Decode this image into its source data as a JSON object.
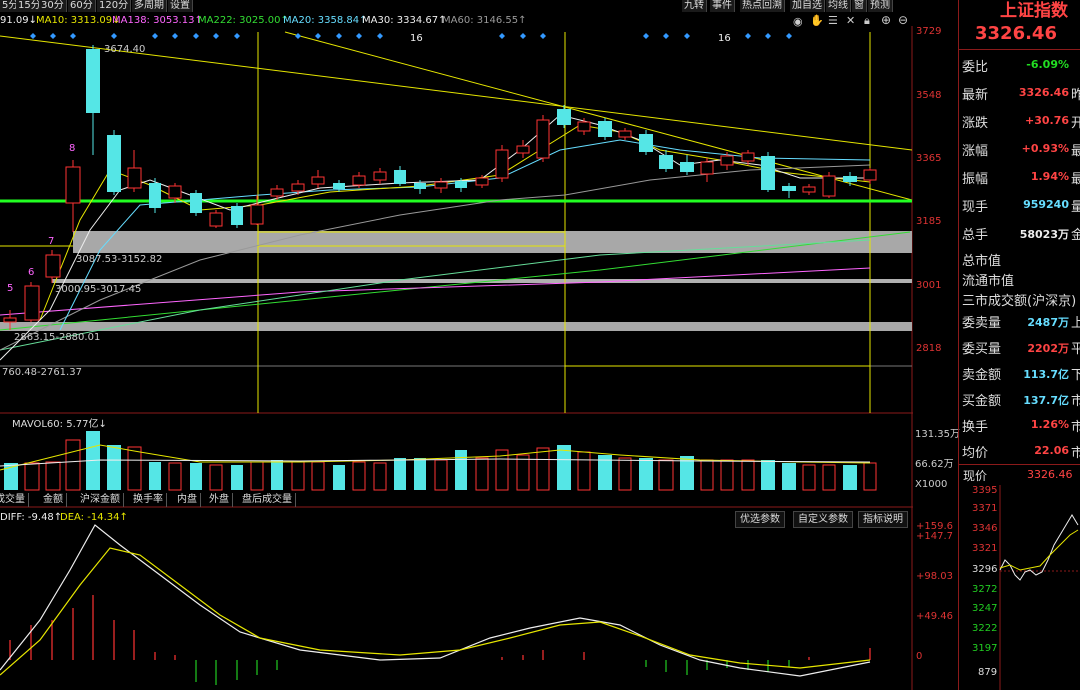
{
  "period_tabs": [
    "5分",
    "15分",
    "30分",
    "60分",
    "120分",
    "多周期",
    "设置"
  ],
  "tools": [
    "九转",
    "事件",
    "热点回溯",
    "加自选",
    "均线",
    "窗",
    "预测"
  ],
  "ma_legend": [
    {
      "text": "91.09↓",
      "color": "#eeeeee"
    },
    {
      "text": "MA10: 3313.09↓",
      "color": "#e6e600"
    },
    {
      "text": "MA138: 3053.13↑",
      "color": "#ff66ff"
    },
    {
      "text": "MA222: 3025.00↑",
      "color": "#33dd33"
    },
    {
      "text": "MA20: 3358.84↑",
      "color": "#66ddff"
    },
    {
      "text": "MA30: 3334.67↑",
      "color": "#eeeeee"
    },
    {
      "text": "MA60: 3146.55↑",
      "color": "#999999"
    }
  ],
  "price_axis": [
    "3729",
    "3548",
    "3365",
    "3185",
    "3001",
    "2818"
  ],
  "chart_labels": {
    "high": "3674.40",
    "count1": "16",
    "count2": "16",
    "n8": "8",
    "n7": "7",
    "n6": "6",
    "n5": "5",
    "zone1": "3087.53-3152.82",
    "zone2": "3000.95-3017.45",
    "zone3": "2863.15-2880.01",
    "zone4": "760.48-2761.37"
  },
  "volume": {
    "legend": "MAVOL60: 5.77亿↓",
    "axis": [
      "131.35万",
      "66.62万",
      "X1000"
    ],
    "tabs": [
      "成交量",
      "金额",
      "沪深金额",
      "换手率",
      "内盘",
      "外盘",
      "盘后成交量"
    ]
  },
  "macd": {
    "diff": "DIFF: -9.48↑",
    "dea": "DEA: -14.34↑",
    "buttons": [
      "优选参数",
      "自定义参数",
      "指标说明"
    ],
    "axis": [
      "+159.6",
      "+147.7",
      "+98.03",
      "+49.46",
      "0"
    ]
  },
  "quote": {
    "title": "上证指数",
    "price": "3326.46",
    "rows": [
      {
        "label": "委比",
        "value": "-6.09%",
        "color": "#22dd22",
        "cut": ""
      },
      {
        "label": "最新",
        "value": "3326.46",
        "color": "#ff4444",
        "cut": "昨"
      },
      {
        "label": "涨跌",
        "value": "+30.76",
        "color": "#ff4444",
        "cut": "开"
      },
      {
        "label": "涨幅",
        "value": "+0.93%",
        "color": "#ff4444",
        "cut": "最"
      },
      {
        "label": "振幅",
        "value": "1.94%",
        "color": "#ff4444",
        "cut": "最"
      },
      {
        "label": "现手",
        "value": "959240",
        "color": "#66ddff",
        "cut": "量"
      },
      {
        "label": "总手",
        "value": "58023万",
        "color": "#eeeeee",
        "cut": "金"
      },
      {
        "label": "总市值",
        "value": "",
        "color": "#eeeeee",
        "cut": ""
      },
      {
        "label": "流通市值",
        "value": "",
        "color": "#eeeeee",
        "cut": ""
      },
      {
        "label": "三市成交额(沪深京)",
        "value": "",
        "color": "#eeeeee",
        "cut": ""
      },
      {
        "label": "委卖量",
        "value": "2487万",
        "color": "#66ddff",
        "cut": "上"
      },
      {
        "label": "委买量",
        "value": "2202万",
        "color": "#ff4444",
        "cut": "平"
      },
      {
        "label": "卖金额",
        "value": "113.7亿",
        "color": "#66ddff",
        "cut": "下"
      },
      {
        "label": "买金额",
        "value": "137.7亿",
        "color": "#66ddff",
        "cut": "市"
      },
      {
        "label": "换手",
        "value": "1.26%",
        "color": "#ff4444",
        "cut": "市"
      },
      {
        "label": "均价",
        "value": "22.06",
        "color": "#ff4444",
        "cut": "市"
      }
    ],
    "mini_label": "现价",
    "mini_price": "3326.46",
    "mini_axis": [
      "3395",
      "3371",
      "3346",
      "3321",
      "3296",
      "3272",
      "3247",
      "3222",
      "3197"
    ],
    "mini_vol": "879"
  }
}
